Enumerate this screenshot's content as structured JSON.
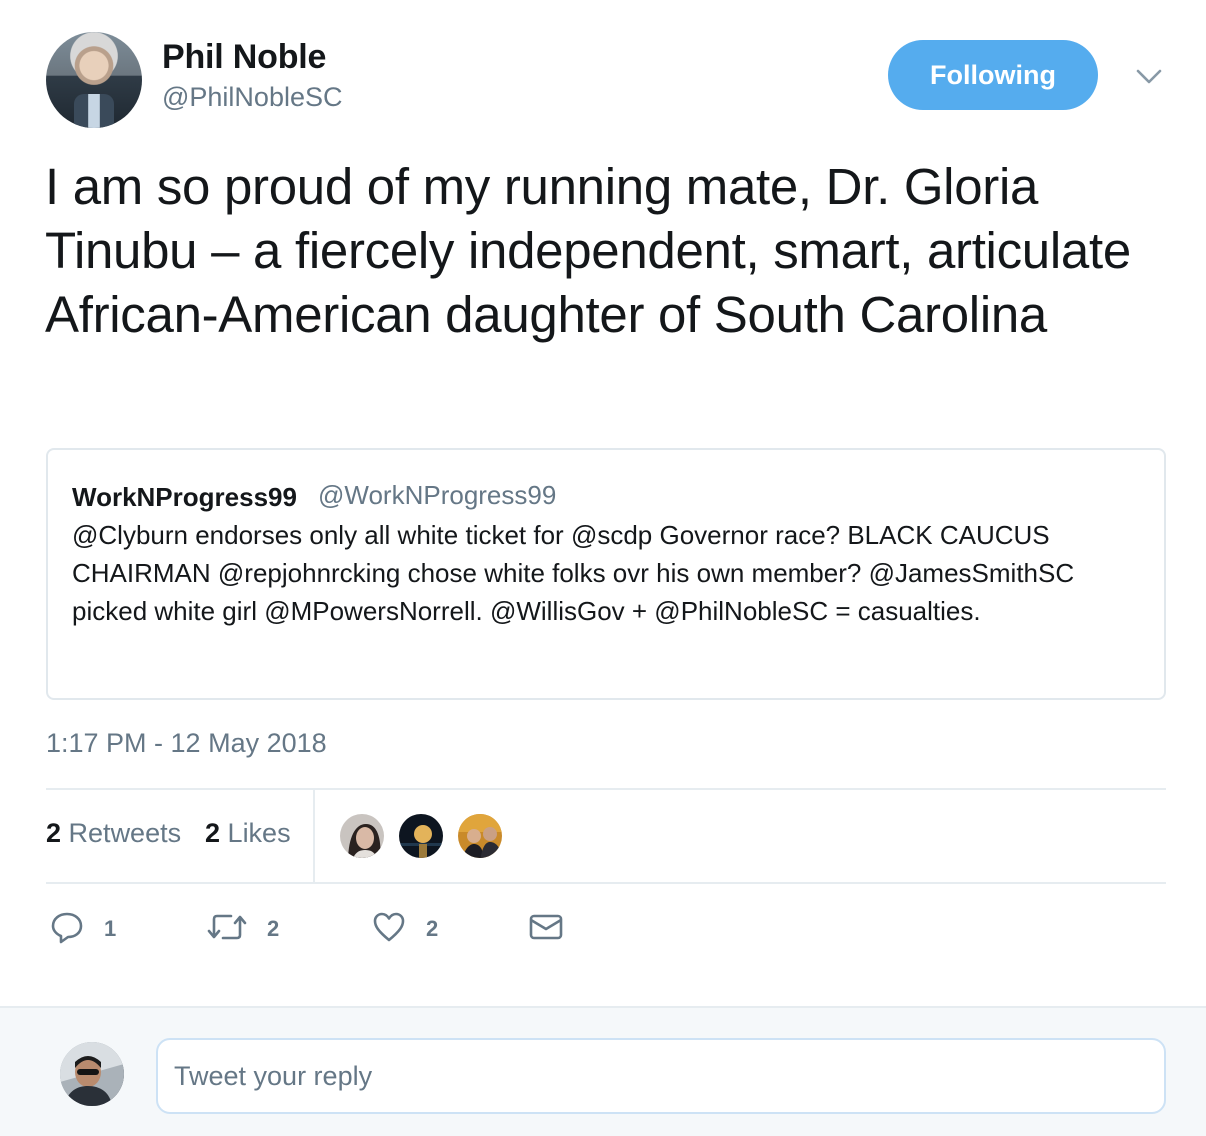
{
  "author": {
    "name": "Phil Noble",
    "handle": "@PhilNobleSC",
    "follow_label": "Following"
  },
  "tweet": {
    "text": "I am so proud of my running mate, Dr. Gloria Tinubu – a fiercely independent, smart, articulate African-American daughter of South Carolina",
    "timestamp": "1:17 PM - 12 May 2018"
  },
  "quoted_tweet": {
    "name": "WorkNProgress99",
    "handle": "@WorkNProgress99",
    "text": "@Clyburn endorses only all white ticket for @scdp Governor race? BLACK CAUCUS CHAIRMAN @repjohnrcking chose white folks ovr his own member? @JamesSmithSC picked white girl @MPowersNorrell. @WillisGov + @PhilNobleSC = casualties."
  },
  "stats": {
    "retweets_count": "2",
    "retweets_label": "Retweets",
    "likes_count": "2",
    "likes_label": "Likes"
  },
  "actions": {
    "reply_count": "1",
    "retweet_count": "2",
    "like_count": "2"
  },
  "reply": {
    "placeholder": "Tweet your reply"
  },
  "colors": {
    "accent": "#55acee",
    "text_secondary": "#657786",
    "text_primary": "#14171a",
    "border": "#e6ecf0"
  },
  "icons": [
    "chevron-down-icon",
    "reply-icon",
    "retweet-icon",
    "heart-icon",
    "mail-icon"
  ]
}
